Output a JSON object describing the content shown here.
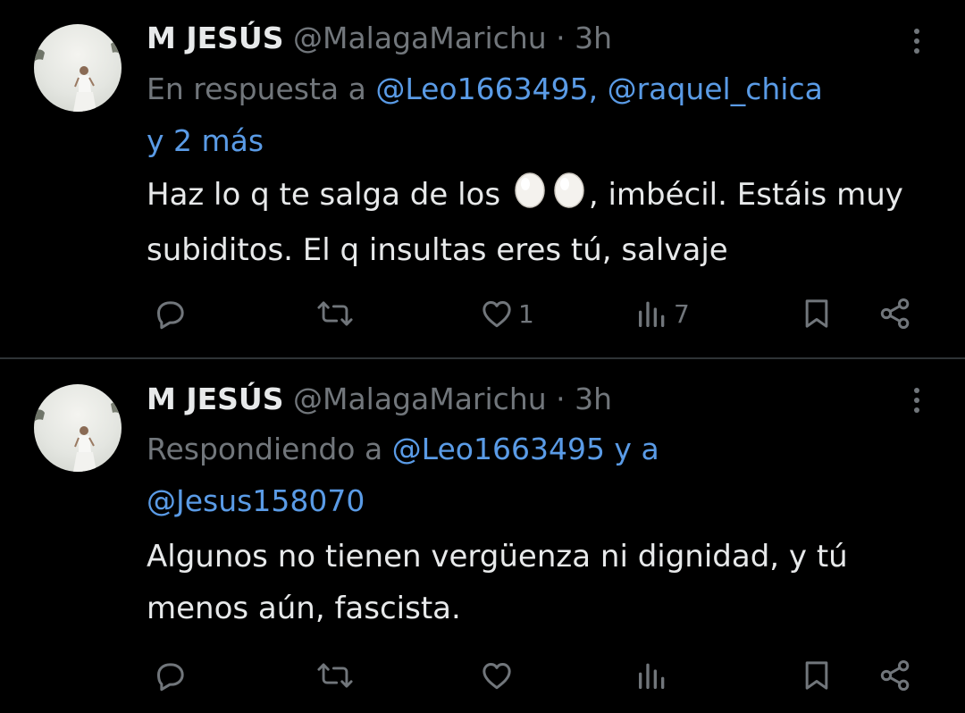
{
  "tweets": [
    {
      "author_name": "M JESÚS",
      "handle": "@MalagaMarichu",
      "separator": "·",
      "time": "3h",
      "reply_prefix": "En respuesta a ",
      "reply_links": [
        "@Leo1663495,",
        "@raquel_chica",
        "y 2 más"
      ],
      "text_before_emoji": "Haz lo q te salga de los ",
      "emoji_names": [
        "egg-emoji",
        "egg-emoji"
      ],
      "text_after_emoji": ", imbécil. Estáis muy subiditos. El q insultas eres tú, salvaje",
      "actions": {
        "reply": "",
        "retweet": "",
        "like": "1",
        "views": "7"
      }
    },
    {
      "author_name": "M JESÚS",
      "handle": "@MalagaMarichu",
      "separator": "·",
      "time": "3h",
      "reply_prefix": "Respondiendo a ",
      "reply_links": [
        "@Leo1663495 y a",
        "@Jesus158070"
      ],
      "text": "Algunos no tienen vergüenza ni dignidad, y tú menos aún, fascista.",
      "actions": {
        "reply": "",
        "retweet": "",
        "like": "",
        "views": ""
      }
    }
  ],
  "icons": {
    "reply": "reply-icon",
    "retweet": "retweet-icon",
    "like": "heart-icon",
    "views": "views-icon",
    "bookmark": "bookmark-icon",
    "share": "share-icon",
    "more": "more-vertical-icon"
  },
  "colors": {
    "background": "#000000",
    "text": "#e7e9ea",
    "muted": "#71767b",
    "link": "#5a9be6",
    "divider": "#2f3336"
  }
}
